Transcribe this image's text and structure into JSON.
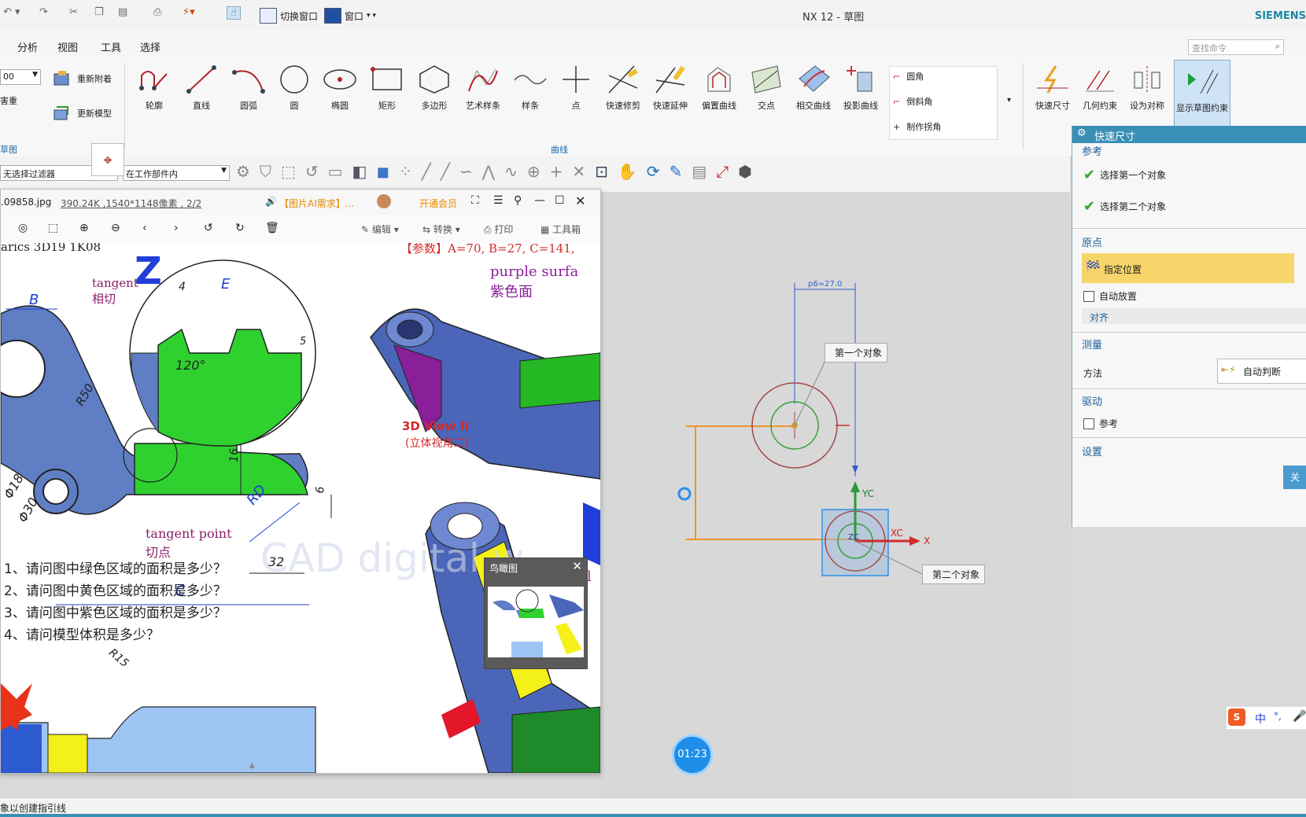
{
  "titlebar": {
    "title": "NX 12 - 草图",
    "brand": "SIEMENS",
    "switch_window": "切换窗口",
    "window": "窗口"
  },
  "menubar": {
    "items": [
      "分析",
      "视图",
      "工具",
      "选择"
    ],
    "search_placeholder": "查找命令"
  },
  "ribbon": {
    "combo_value": "00",
    "left_label": "害重",
    "reattach": "重新附着",
    "update_model": "更新模型",
    "sketch_group_label": "草图",
    "curve_group_label": "曲线",
    "tools": [
      "轮廓",
      "直线",
      "圆弧",
      "圆",
      "椭圆",
      "矩形",
      "多边形",
      "艺术样条",
      "样条",
      "点",
      "快速修剪",
      "快速延伸",
      "偏置曲线",
      "交点",
      "相交曲线",
      "投影曲线"
    ],
    "corner_tools": [
      "圆角",
      "倒斜角",
      "制作拐角"
    ],
    "constraint_tools": [
      "快速尺寸",
      "几何约束",
      "设为对称",
      "显示草图约束"
    ]
  },
  "toolrow": {
    "filter": "无选择过滤器",
    "scope": "在工作部件内"
  },
  "viewer": {
    "filename": ".09858.jpg",
    "info": "390.24K ,1540*1148像素 , 2/2",
    "ai_promo": "【图片AI需求】...",
    "vip": "开通会员",
    "tools": {
      "edit": "编辑",
      "convert": "转换",
      "print": "打印",
      "toolbox": "工具箱"
    },
    "birdseye_title": "鸟瞰图"
  },
  "drawing": {
    "header_left": "arics 3D19 1K08",
    "params": "【参数】A=70, B=27, C=141,",
    "tangent_en": "tangent",
    "tangent_cn": "相切",
    "dim_4": "4",
    "dim_E": "E",
    "dim_5": "5",
    "angle": "120°",
    "dim_B": "B",
    "dim_R50": "R50",
    "purple_en": "purple surfa",
    "purple_cn": "紫色面",
    "view_en": "3D View II",
    "view_cn": "(立体视角二)",
    "phi18": "Φ18",
    "phi30": "Φ30",
    "dim_16": "16",
    "dim_RD": "RD",
    "dim_6": "6",
    "dim_32": "32",
    "dim_C": "C",
    "tpoint_en": "tangent point",
    "tpoint_cn": "切点",
    "yellow_en": "yel",
    "questions": [
      "1、请问图中绿色区域的面积是多少？",
      "2、请问图中黄色区域的面积是多少？",
      "3、请问图中紫色区域的面积是多少？",
      "4、请问模型体积是多少？"
    ],
    "dim_R15": "R15",
    "watermark": "CAD digital w"
  },
  "canvas": {
    "dim_label": "p6=27.0",
    "first_object": "第一个对象",
    "second_object": "第二个对象",
    "yc": "YC",
    "xc": "XC",
    "x": "X",
    "zc": "ZC",
    "timer": "01:23"
  },
  "dialog": {
    "title": "快速尺寸",
    "ref_section": "参考",
    "first_obj": "选择第一个对象",
    "second_obj": "选择第二个对象",
    "origin_section": "原点",
    "specify_location": "指定位置",
    "auto_place": "自动放置",
    "align": "对齐",
    "measure_section": "测量",
    "method_label": "方法",
    "method_value": "自动判断",
    "drive_section": "驱动",
    "reference": "参考",
    "settings_section": "设置",
    "close_button": "关"
  },
  "ime": {
    "lang": "中",
    "punct": "°,"
  },
  "statusbar": {
    "text": "象以创建指引线"
  }
}
